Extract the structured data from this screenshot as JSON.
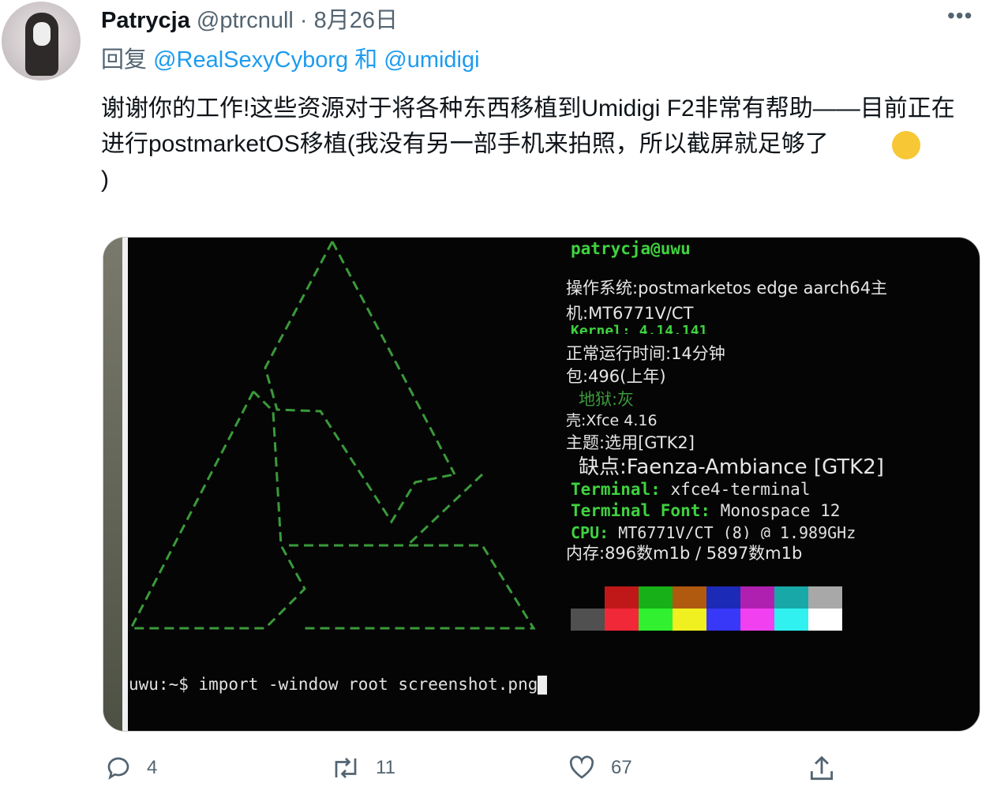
{
  "tweet": {
    "display_name": "Patrycja",
    "handle": "@ptrcnull",
    "separator": "·",
    "date": "8月26日",
    "reply_prefix": "回复",
    "reply_to_1": "@RealSexyCyborg",
    "reply_and": "和",
    "reply_to_2": "@umidigi",
    "body": "谢谢你的工作!这些资源对于将各种东西移植到Umidigi F2非常有帮助——目前正在进行postmarketOS移植(我没有另一部手机来拍照，所以截屏就足够了",
    "body_end": ")",
    "more_icon": "more-horizontal-icon",
    "emoji": "sweat-smile-emoji"
  },
  "terminal": {
    "user_host": "patrycja@uwu",
    "lines": [
      "操作系统:postmarketos edge aarch64主",
      "机:MT6771V/CT",
      "Kernel: 4.14.141",
      "正常运行时间:14分钟",
      "包:496(上年)",
      "地狱:灰",
      "壳:Xfce 4.16",
      "主题:选用[GTK2]",
      "缺点:Faenza-Ambiance [GTK2]"
    ],
    "terminal_label": "Terminal",
    "terminal_value": "xfce4-terminal",
    "font_label": "Terminal Font",
    "font_value": "Monospace 12",
    "cpu_label": "CPU",
    "cpu_value": "MT6771V/CT (8) @ 1.989GHz",
    "memory": "内存:896数m1b / 5897数m1b",
    "prompt": "uwu:~$ import -window root screenshot.png",
    "palette_top": [
      "#050505",
      "#c01818",
      "#18b018",
      "#b05a10",
      "#1c2ab8",
      "#b020b0",
      "#18a8a8",
      "#a8a8a8"
    ],
    "palette_bottom": [
      "#505050",
      "#f02838",
      "#30f030",
      "#f0f020",
      "#3838f8",
      "#f040f0",
      "#30f0f0",
      "#ffffff"
    ],
    "logo_color": "#3a9a3a"
  },
  "actions": {
    "reply_count": "4",
    "retweet_count": "11",
    "like_count": "67"
  }
}
